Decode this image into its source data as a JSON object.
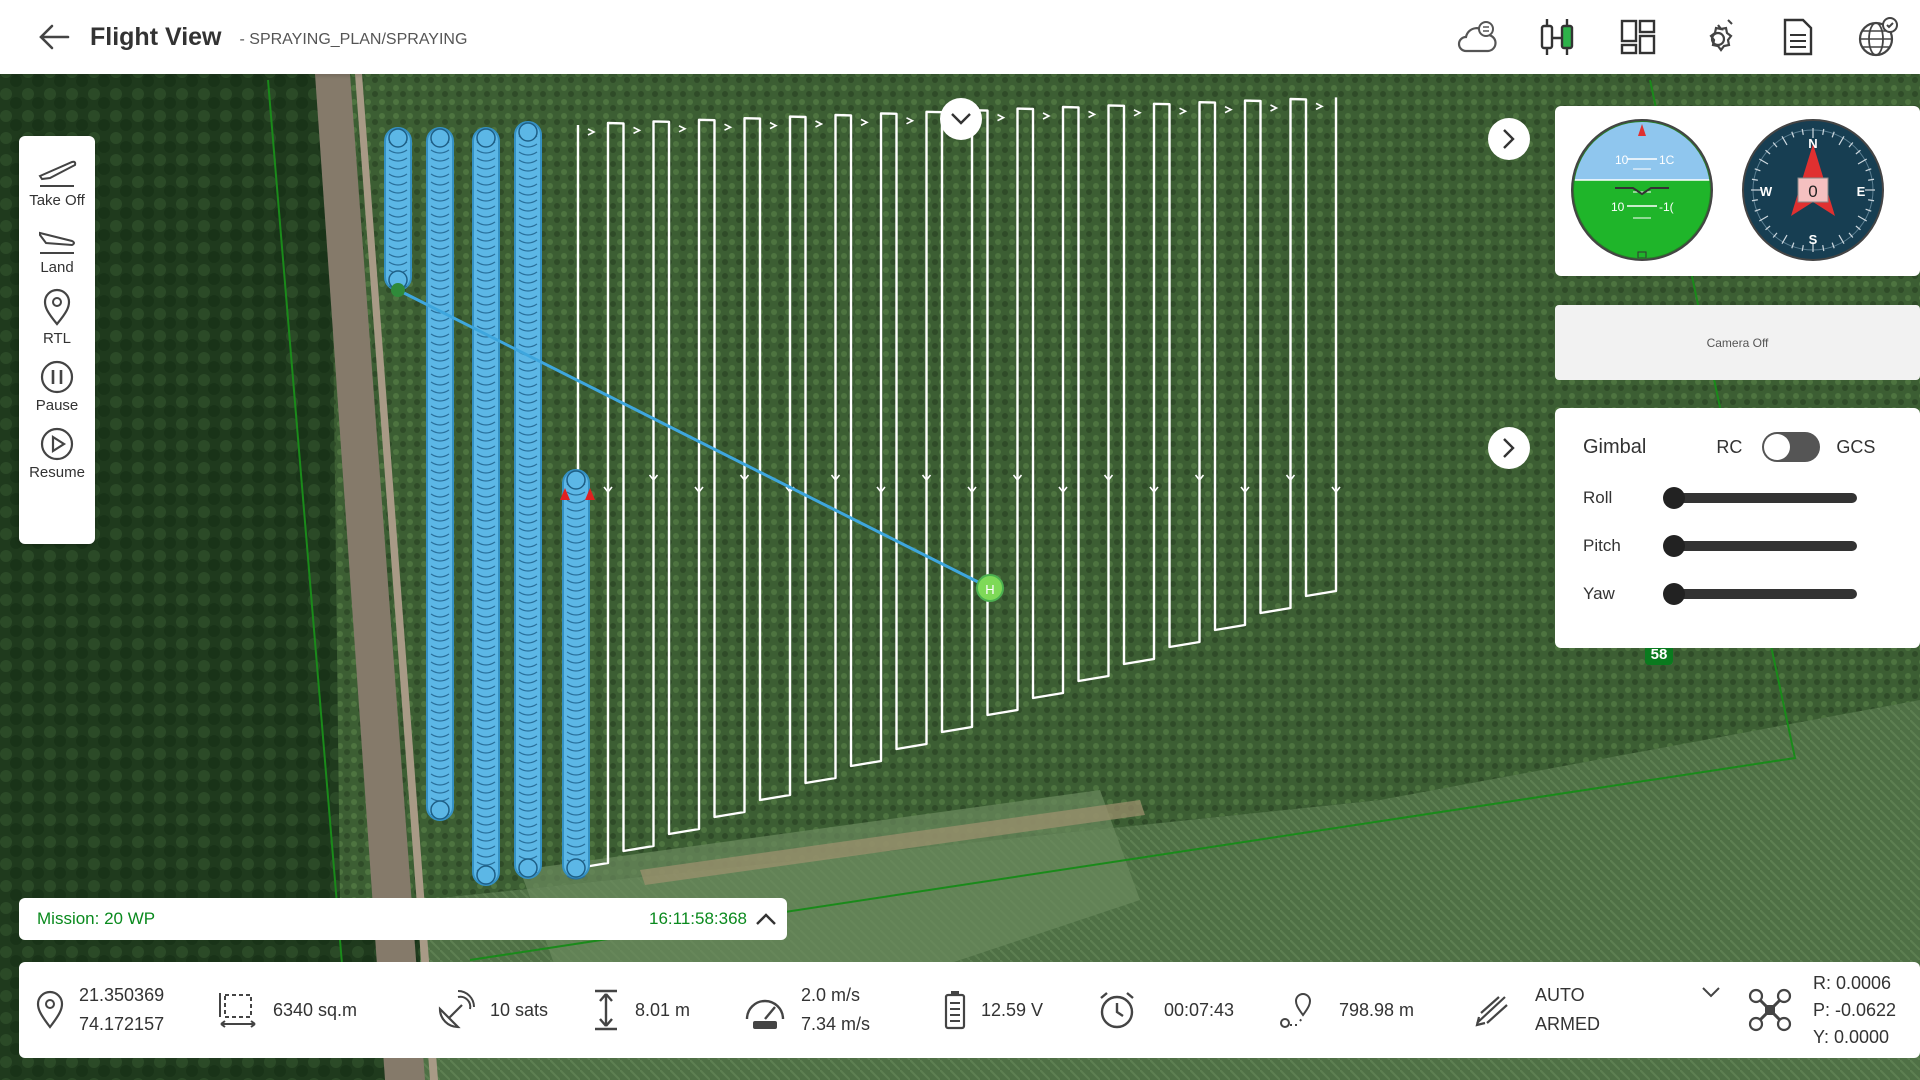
{
  "header": {
    "title": "Flight View",
    "subtitle": "- SPRAYING_PLAN/SPRAYING",
    "tools": [
      "weather-sync-icon",
      "telemetry-link-icon",
      "layout-icon",
      "settings-icon",
      "log-icon",
      "map-globe-icon"
    ]
  },
  "actions": {
    "takeoff": "Take Off",
    "land": "Land",
    "rtl": "RTL",
    "pause": "Pause",
    "resume": "Resume"
  },
  "hud": {
    "ahrs_ticks": [
      "10",
      "1C",
      "10",
      "-1(",
      "10"
    ],
    "compass_n": "N",
    "compass_s": "S",
    "compass_e": "E",
    "compass_w": "W",
    "heading": "0"
  },
  "camera": {
    "label": "Camera Off"
  },
  "gimbal": {
    "title": "Gimbal",
    "rc": "RC",
    "gcs": "GCS",
    "roll": "Roll",
    "pitch": "Pitch",
    "yaw": "Yaw",
    "roll_value": 0,
    "pitch_value": 0,
    "yaw_value": 0
  },
  "map": {
    "waypoint_badge": "58",
    "colors": {
      "path": "#ffffff",
      "track": "#3ea6dd",
      "boundary": "#1a8a1a",
      "home": "#7ed957"
    }
  },
  "mission": {
    "label": "Mission: 20 WP",
    "time": "16:11:58:368"
  },
  "status": {
    "lat": "21.350369",
    "lon": "74.172157",
    "area": "6340 sq.m",
    "sats": "10 sats",
    "altitude": "8.01 m",
    "speed_ground": "2.0 m/s",
    "speed_air": "7.34 m/s",
    "voltage": "12.59 V",
    "timer": "00:07:43",
    "distance": "798.98 m",
    "mode": "AUTO",
    "armed": "ARMED",
    "roll": "R: 0.0006",
    "pitch": "P: -0.0622",
    "yaw": "Y: 0.0000"
  }
}
